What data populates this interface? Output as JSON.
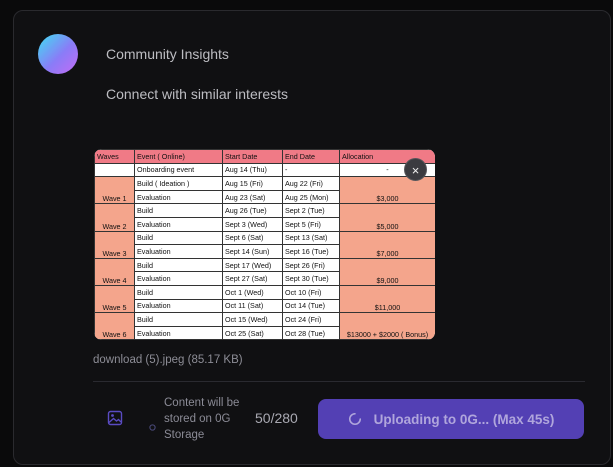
{
  "post": {
    "title": "Community Insights",
    "subtitle": "Connect with similar interests"
  },
  "attachment": {
    "filename": "download (5).jpeg (85.17 KB)",
    "close_icon": "×",
    "table": {
      "headers": [
        "Waves",
        "Event ( Online)",
        "Start Date",
        "End Date",
        "Allocation"
      ],
      "onboarding": {
        "event": "Onboarding event",
        "start": "Aug 14 (Thu)",
        "end": "-",
        "alloc": "-"
      },
      "waves": [
        {
          "wave": "Wave 1",
          "build": "Build ( Ideation )",
          "build_start": "Aug 15 (Fri)",
          "build_end": "Aug 22 (Fri)",
          "eval": "Evaluation",
          "eval_start": "Aug 23 (Sat)",
          "eval_end": "Aug 25 (Mon)",
          "alloc": "$3,000"
        },
        {
          "wave": "Wave 2",
          "build": "Build",
          "build_start": "Aug 26 (Tue)",
          "build_end": "Sept 2 (Tue)",
          "eval": "Evaluation",
          "eval_start": "Sept 3 (Wed)",
          "eval_end": "Sept 5 (Fri)",
          "alloc": "$5,000"
        },
        {
          "wave": "Wave 3",
          "build": "Build",
          "build_start": "Sept 6 (Sat)",
          "build_end": "Sept 13 (Sat)",
          "eval": "Evaluation",
          "eval_start": "Sept 14 (Sun)",
          "eval_end": "Sept 16 (Tue)",
          "alloc": "$7,000"
        },
        {
          "wave": "Wave 4",
          "build": "Build",
          "build_start": "Sept 17 (Wed)",
          "build_end": "Sept 26 (Fri)",
          "eval": "Evaluation",
          "eval_start": "Sept 27 (Sat)",
          "eval_end": "Sept 30 (Tue)",
          "alloc": "$9,000"
        },
        {
          "wave": "Wave 5",
          "build": "Build",
          "build_start": "Oct 1 (Wed)",
          "build_end": "Oct 10 (Fri)",
          "eval": "Evaluation",
          "eval_start": "Oct 11 (Sat)",
          "eval_end": "Oct 14 (Tue)",
          "alloc": "$11,000"
        },
        {
          "wave": "Wave 6",
          "build": "Build",
          "build_start": "Oct 15 (Wed)",
          "build_end": "Oct 24 (Fri)",
          "eval": "Evaluation",
          "eval_start": "Oct 25 (Sat)",
          "eval_end": "Oct 28 (Tue)",
          "alloc": "$13000 + $2000 ( Bonus)"
        }
      ]
    }
  },
  "footer": {
    "image_icon": "image-icon",
    "storage_note": "Content will be stored on 0G Storage",
    "counter": "50/280",
    "upload_label": "Uploading to 0G... (Max 45s)"
  },
  "colors": {
    "accent": "#5340b4",
    "header_row": "#f07a86",
    "wave_cell": "#f4a58c"
  }
}
